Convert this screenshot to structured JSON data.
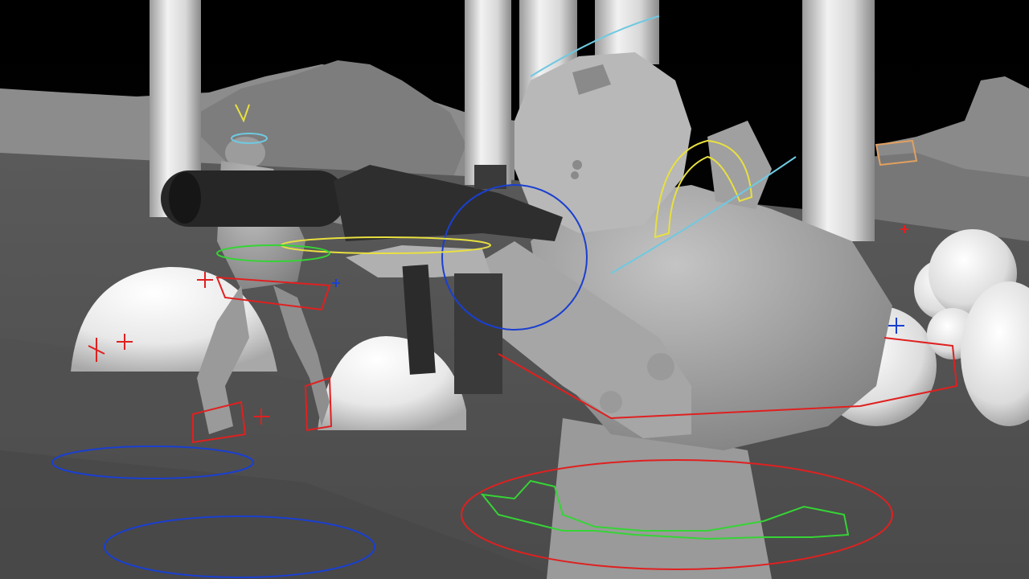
{
  "viewport": {
    "kind": "3d-animation-viewport",
    "shading": "grey-solid",
    "background": "#000000"
  },
  "colors": {
    "ground": "#6e6e6e",
    "terrain": "#8a8a8a",
    "pillar": "#dcdcdc",
    "character": "#a9a9a9",
    "weapon": "#2a2a2a",
    "control_red": "#e02020",
    "control_green": "#35d435",
    "control_blue": "#1a3fd0",
    "control_yellow": "#e8e040",
    "control_cyan": "#6fc9e0",
    "control_orange": "#e0a060"
  },
  "characters": [
    {
      "name": "background-soldier",
      "icon": "rig-character"
    },
    {
      "name": "foreground-soldier",
      "icon": "rig-character"
    }
  ],
  "props": [
    "pillars",
    "domes",
    "spheres",
    "rifle"
  ]
}
